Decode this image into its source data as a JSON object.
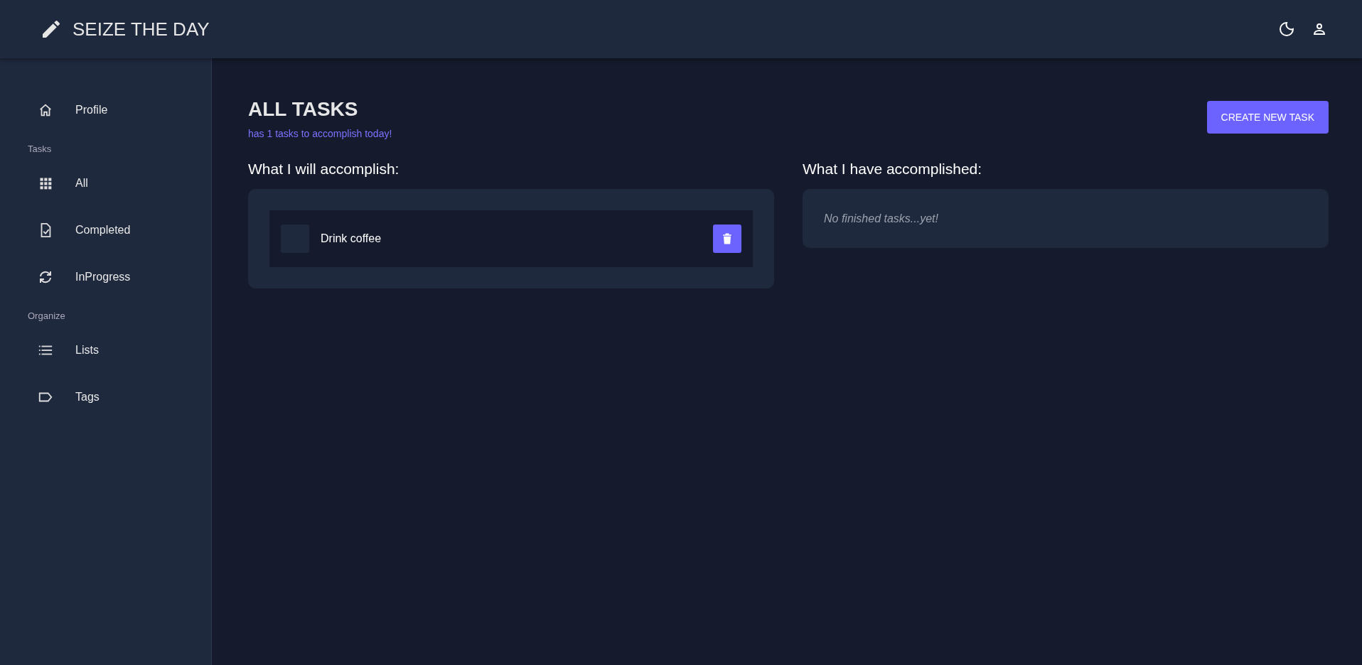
{
  "app": {
    "title": "SEIZE THE DAY"
  },
  "sidebar": {
    "items": [
      {
        "kind": "link",
        "label": "Profile"
      },
      {
        "kind": "section",
        "label": "Tasks"
      },
      {
        "kind": "link",
        "label": "All"
      },
      {
        "kind": "link",
        "label": "Completed"
      },
      {
        "kind": "link",
        "label": "InProgress"
      },
      {
        "kind": "section",
        "label": "Organize"
      },
      {
        "kind": "link",
        "label": "Lists"
      },
      {
        "kind": "link",
        "label": "Tags"
      }
    ]
  },
  "main": {
    "title": "ALL TASKS",
    "subtitle": "has 1 tasks to accomplish today!",
    "create_button": "CREATE NEW TASK",
    "todo": {
      "heading": "What I will accomplish:",
      "tasks": [
        {
          "text": "Drink coffee",
          "checked": false
        }
      ]
    },
    "done": {
      "heading": "What I have accomplished:",
      "empty_text": "No finished tasks...yet!"
    }
  }
}
